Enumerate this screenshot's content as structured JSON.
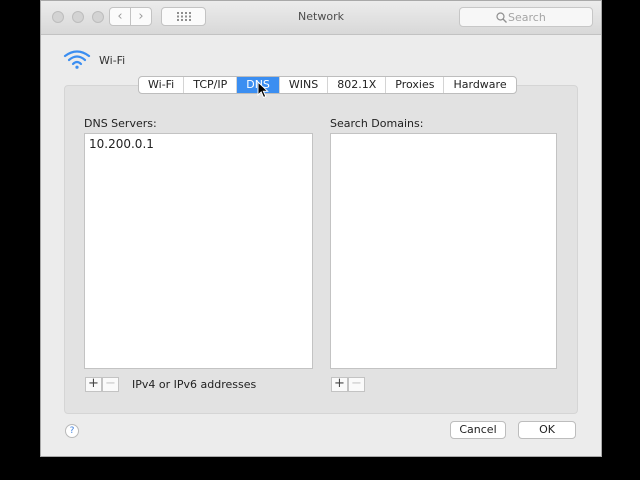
{
  "window": {
    "title": "Network"
  },
  "toolbar": {
    "back_glyph": "‹",
    "forward_glyph": "›",
    "search_placeholder": "Search",
    "search_value": ""
  },
  "interface": {
    "name": "Wi-Fi",
    "icon": "wifi-icon"
  },
  "tabs": [
    {
      "label": "Wi-Fi",
      "active": false
    },
    {
      "label": "TCP/IP",
      "active": false
    },
    {
      "label": "DNS",
      "active": true
    },
    {
      "label": "WINS",
      "active": false
    },
    {
      "label": "802.1X",
      "active": false
    },
    {
      "label": "Proxies",
      "active": false
    },
    {
      "label": "Hardware",
      "active": false
    }
  ],
  "dns": {
    "servers_label": "DNS Servers:",
    "servers": [
      "10.200.0.1"
    ],
    "domains_label": "Search Domains:",
    "domains": [],
    "add_glyph": "+",
    "remove_glyph": "−",
    "hint": "IPv4 or IPv6 addresses"
  },
  "footer": {
    "help_glyph": "?",
    "cancel_label": "Cancel",
    "ok_label": "OK"
  },
  "colors": {
    "accent": "#3b8ef1",
    "window_bg": "#ececec",
    "panel_bg": "#e2e2e2"
  }
}
